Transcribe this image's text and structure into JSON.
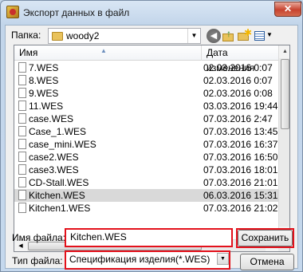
{
  "window": {
    "title": "Экспорт данных в файл",
    "close_glyph": "✕"
  },
  "folder": {
    "label": "Папка:",
    "value": "woody2",
    "icon": "folder-icon"
  },
  "toolbar": {
    "back_glyph": "◀",
    "up_glyph": "↑",
    "new_glyph": "✱",
    "view_dropdown_glyph": "▼"
  },
  "list": {
    "columns": {
      "name": "Имя",
      "date": "Дата изменения"
    },
    "sort_glyph": "▲",
    "rows": [
      {
        "name": "7.WES",
        "date": "02.03.2016 0:07"
      },
      {
        "name": "8.WES",
        "date": "02.03.2016 0:07"
      },
      {
        "name": "9.WES",
        "date": "02.03.2016 0:08"
      },
      {
        "name": "11.WES",
        "date": "03.03.2016 19:44"
      },
      {
        "name": "case.WES",
        "date": "07.03.2016 2:47"
      },
      {
        "name": "Case_1.WES",
        "date": "07.03.2016 13:45"
      },
      {
        "name": "case_mini.WES",
        "date": "07.03.2016 16:37"
      },
      {
        "name": "case2.WES",
        "date": "07.03.2016 16:50"
      },
      {
        "name": "case3.WES",
        "date": "07.03.2016 18:01"
      },
      {
        "name": "CD-Stall.WES",
        "date": "07.03.2016 21:01"
      },
      {
        "name": "Kitchen.WES",
        "date": "06.03.2016 15:31",
        "selected": true
      },
      {
        "name": "Kitchen1.WES",
        "date": "07.03.2016 21:02"
      }
    ],
    "scroll_up": "▲",
    "scroll_down": "▼",
    "scroll_left": "◀",
    "scroll_right": "▶"
  },
  "filename": {
    "label": "Имя файла:",
    "value": "Kitchen.WES"
  },
  "filetype": {
    "label": "Тип файла:",
    "value": "Спецификация изделия(*.WES)",
    "arrow": "▼"
  },
  "buttons": {
    "save": "Сохранить",
    "cancel": "Отмена"
  },
  "colors": {
    "highlight": "#e3111b",
    "selected_row": "#d9d9d9"
  }
}
